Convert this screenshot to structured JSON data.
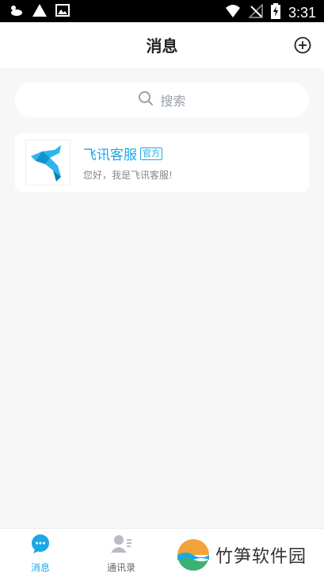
{
  "status_bar": {
    "time": "3:31",
    "left_icons": [
      "cloud-sun-icon",
      "warning-icon",
      "image-icon"
    ],
    "right_icons": [
      "wifi-icon",
      "no-signal-icon",
      "battery-charging-icon"
    ]
  },
  "header": {
    "title": "消息",
    "action_icon": "add-circle-icon"
  },
  "search": {
    "placeholder": "搜索",
    "icon": "search-icon"
  },
  "conversations": [
    {
      "name": "飞讯客服",
      "badge": "官方",
      "preview": "您好，我是飞讯客服!",
      "avatar_icon": "dolphin-icon"
    }
  ],
  "bottom_nav": {
    "items": [
      {
        "label": "消息",
        "icon": "chat-bubble-icon",
        "active": true
      },
      {
        "label": "通讯录",
        "icon": "contacts-icon",
        "active": false
      }
    ]
  },
  "watermark": {
    "text": "竹笋软件园"
  },
  "colors": {
    "accent": "#1aa9e6",
    "background": "#f7f7f7",
    "title": "#222222",
    "muted": "#888888"
  }
}
